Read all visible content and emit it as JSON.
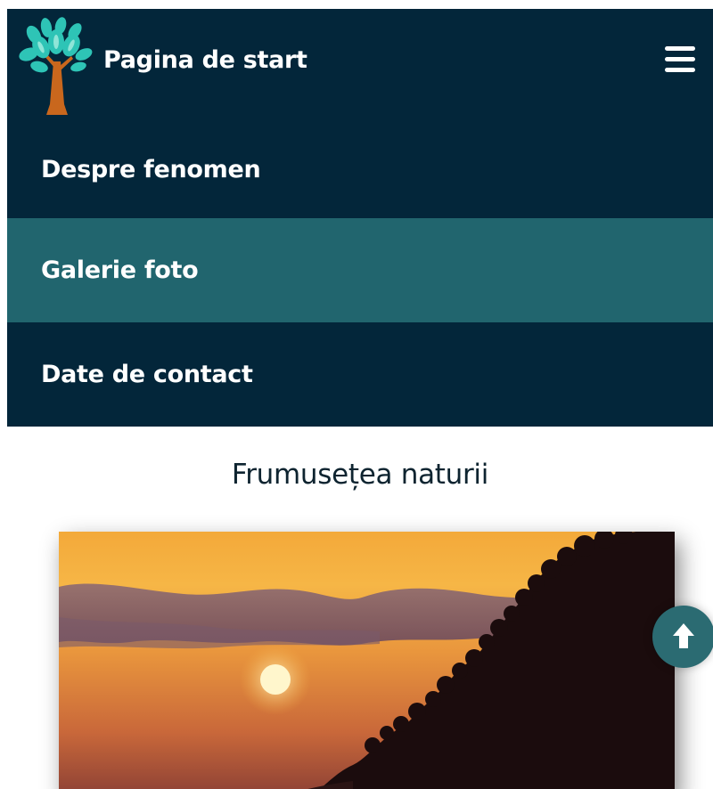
{
  "header": {
    "brand_label": "Pagina de start",
    "logo_icon": "tree-logo-icon",
    "menu_icon": "hamburger-menu-icon"
  },
  "menu": {
    "items": [
      {
        "label": "Despre fenomen",
        "active": false
      },
      {
        "label": "Galerie foto",
        "active": true
      },
      {
        "label": "Date de contact",
        "active": false
      }
    ]
  },
  "main": {
    "heading": "Frumusețea naturii"
  },
  "scroll_top_icon": "arrow-up-icon",
  "colors": {
    "nav_background": "#03263a",
    "active_item_background": "#21656e",
    "scroll_button": "#2b6b72",
    "logo_leaves": "#2ec4b6",
    "logo_trunk": "#c9671d"
  }
}
